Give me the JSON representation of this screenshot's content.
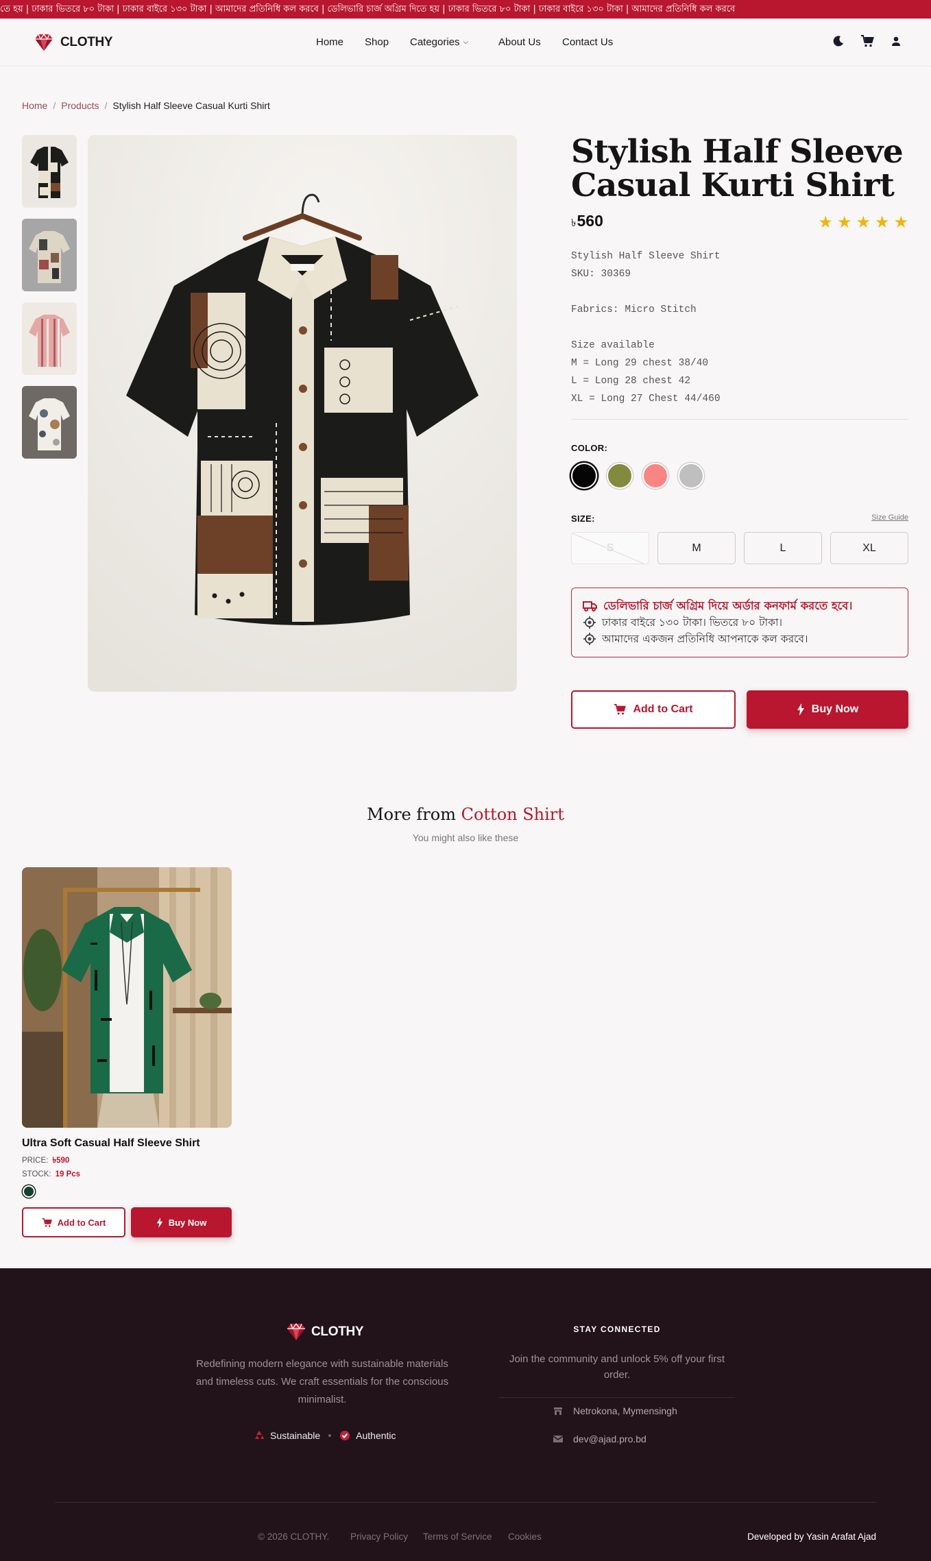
{
  "marquee": {
    "text": "তে হয় | ঢাকার ভিতরে ৮০ টাকা | ঢাকার বাইরে ১৩০ টাকা | আমাদের প্রতিনিধি কল করবে |  ডেলিভারি চার্জ অগ্রিম দিতে হয় | ঢাকার ভিতরে ৮০ টাকা | ঢাকার বাইরে ১৩০ টাকা | আমাদের প্রতিনিধি কল করবে"
  },
  "brand": {
    "name": "CLOTHY",
    "accent": "#b8172f"
  },
  "nav": {
    "items": [
      {
        "label": "Home"
      },
      {
        "label": "Shop"
      },
      {
        "label": "Categories"
      },
      {
        "label": "About Us"
      },
      {
        "label": "Contact Us"
      }
    ],
    "icons": [
      "moon-icon",
      "cart-icon",
      "user-icon"
    ]
  },
  "breadcrumb": {
    "home": "Home",
    "products": "Products",
    "current": "Stylish Half Sleeve Casual Kurti Shirt"
  },
  "product": {
    "title": "Stylish Half Sleeve Casual Kurti Shirt",
    "currency": "৳",
    "price": "560",
    "rating": 5,
    "description": {
      "subtitle": "Stylish Half Sleeve Shirt",
      "sku": "SKU: 30369",
      "fabrics": "Fabrics: Micro Stitch",
      "size_heading": "Size available",
      "size_m": "M = Long 29 chest 38/40",
      "size_l": "L = Long 28 chest 42",
      "size_xl": "XL = Long 27 Chest 44/460"
    },
    "color_label": "COLOR:",
    "colors": [
      "#050505",
      "#838a3e",
      "#f98582",
      "#bfbfbf"
    ],
    "size_label": "SIZE:",
    "size_guide": "Size Guide",
    "sizes": [
      {
        "label": "S",
        "available": false
      },
      {
        "label": "M",
        "available": true
      },
      {
        "label": "L",
        "available": true
      },
      {
        "label": "XL",
        "available": true
      }
    ],
    "notice": {
      "head": "ডেলিভারি চার্জ অগ্রিম দিয়ে অর্ডার কনফার্ম করতে হবে।",
      "line1": "ঢাকার বাইরে ১৩০ টাকা। ভিতরে ৮০ টাকা।",
      "line2": "আমাদের একজন প্রতিনিধি আপনাকে কল করবে।"
    },
    "add_to_cart": "Add to Cart",
    "buy_now": "Buy Now"
  },
  "more": {
    "title_prefix": "More from",
    "title_accent": "Cotton Shirt",
    "subtitle": "You might also like these",
    "card": {
      "name": "Ultra Soft Casual Half Sleeve Shirt",
      "price_label": "PRICE:",
      "price": "৳590",
      "stock_label": "STOCK:",
      "stock": "19 Pcs",
      "color": "#13432e",
      "add_to_cart": "Add to Cart",
      "buy_now": "Buy Now"
    }
  },
  "footer": {
    "brand": "CLOTHY",
    "tagline": "Redefining modern elegance with sustainable materials and timeless cuts. We craft essentials for the conscious minimalist.",
    "badge1": "Sustainable",
    "badge2": "Authentic",
    "stay": "STAY CONNECTED",
    "join": "Join the community and unlock 5% off your first order.",
    "location": "Netrokona, Mymensingh",
    "email": "dev@ajad.pro.bd",
    "copyright": "© 2026 CLOTHY.",
    "links": [
      "Privacy Policy",
      "Terms of Service",
      "Cookies"
    ],
    "dev_prefix": "Developed by",
    "dev_name": "Yasin Arafat Ajad"
  }
}
